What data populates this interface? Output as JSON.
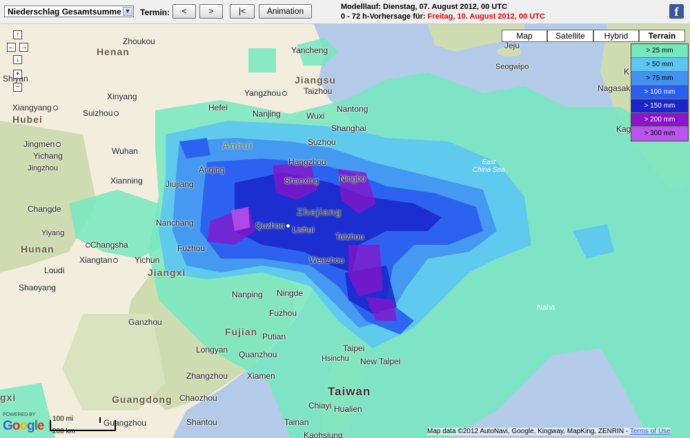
{
  "toolbar": {
    "select_value": "Niederschlag Gesamtsumme",
    "termin_label": "Termin:",
    "prev_label": "<",
    "next_label": ">",
    "first_label": "|<",
    "animation_label": "Animation",
    "modelllauf": "Modelllauf: Dienstag, 07. August 2012, 00 UTC",
    "vorhersage_prefix": "0 - 72 h-Vorhersage für:",
    "vorhersage_date": "Freitag, 10. August 2012, 00 UTC",
    "facebook": "f"
  },
  "map_controls": {
    "up": "↑",
    "left": "←",
    "right": "→",
    "down": "↓",
    "zoom_in": "+",
    "zoom_out": "−"
  },
  "map_types": [
    "Map",
    "Satellite",
    "Hybrid",
    "Terrain"
  ],
  "legend": [
    {
      "label": "> 25 mm",
      "color": "#75e8bf"
    },
    {
      "label": "> 50 mm",
      "color": "#5cc7f2"
    },
    {
      "label": "> 75 mm",
      "color": "#4293ef"
    },
    {
      "label": "> 100 mm",
      "color": "#2a5cf0"
    },
    {
      "label": "> 150 mm",
      "color": "#1a26c9"
    },
    {
      "label": "> 200 mm",
      "color": "#8a14c9"
    },
    {
      "label": "> 300 mm",
      "color": "#bb55f0"
    }
  ],
  "provinces": {
    "henan": "Henan",
    "hubei": "Hubei",
    "anhui": "Anhui",
    "jiangsu": "Jiangsu",
    "zhejiang": "Zhejiang",
    "hunan": "Hunan",
    "jiangxi": "Jiangxi",
    "fujian": "Fujian",
    "guangdong": "Guangdong",
    "taiwan": "Taiwan",
    "gxi": "gxi"
  },
  "cities": {
    "zhoukou": "Zhoukou",
    "xinyang": "Xinyang",
    "xiangyang": "Xiangyang",
    "suizhou": "Suizhou",
    "jingmen": "Jingmen",
    "yichang": "Yichang",
    "jingzhou": "Jingzhou",
    "wuhan": "Wuhan",
    "xianning": "Xianning",
    "hefei": "Hefei",
    "anqing": "Anqing",
    "jiujiang": "Jiujiang",
    "yancheng": "Yancheng",
    "yangzhou": "Yangzhou",
    "taizhou_js": "Taizhou",
    "nanjing": "Nanjing",
    "wuxi": "Wuxi",
    "nantong": "Nantong",
    "shanghai": "Shanghai",
    "suzhou": "Suzhou",
    "hangzhou": "Hangzhou",
    "shaoxing": "Shaoxing",
    "ningbo": "Ningbo",
    "quzhou": "Quzhou",
    "lishui": "Lishui",
    "taizhou_zj": "Taizhou",
    "wenzhou": "Wenzhou",
    "changde": "Changde",
    "nanchang": "Nanchang",
    "yiyang": "Yiyang",
    "changsha": "Changsha",
    "fuzhou_jx": "Fuzhou",
    "xiangtan": "Xiangtan",
    "yichun": "Yichun",
    "loudi": "Loudi",
    "shaoyang": "Shaoyang",
    "nanping": "Nanping",
    "ningde": "Ningde",
    "fuzhou_fj": "Fuzhou",
    "ganzhou": "Ganzhou",
    "putian": "Putian",
    "longyan": "Longyan",
    "quanzhou": "Quanzhou",
    "zhangzhou": "Zhangzhou",
    "xiamen": "Xiamen",
    "chaozhou": "Chaozhou",
    "shantou": "Shantou",
    "guangzhou": "Guangzhou",
    "taipei": "Taipei",
    "hsinchu": "Hsinchu",
    "new_taipei": "New Taipei",
    "chiayi": "Chiayi",
    "hualien": "Hualien",
    "tainan": "Tainan",
    "kaohsiung": "Kaohsiung",
    "jeju": "Jeju",
    "seogwipo": "Seogwipo",
    "nagasaki": "Nagasak",
    "kag": "Kag",
    "naha": "Naha",
    "shiyan": "Shiyan",
    "k": "K"
  },
  "sea_label": "East\nChina Sea",
  "scale": {
    "km_label": "100 mi",
    "mi_label": "200 km"
  },
  "powered_by": "POWERED BY",
  "google_logo": "Google",
  "attribution": "Map data ©2012 AutoNavi, Google, Kingway, MapKing, ZENRIN -",
  "terms": "Terms of Use",
  "colors": {
    "sea": "#b3cbe8",
    "land": "#f2eddc",
    "mountains": "#cfdcb2"
  }
}
